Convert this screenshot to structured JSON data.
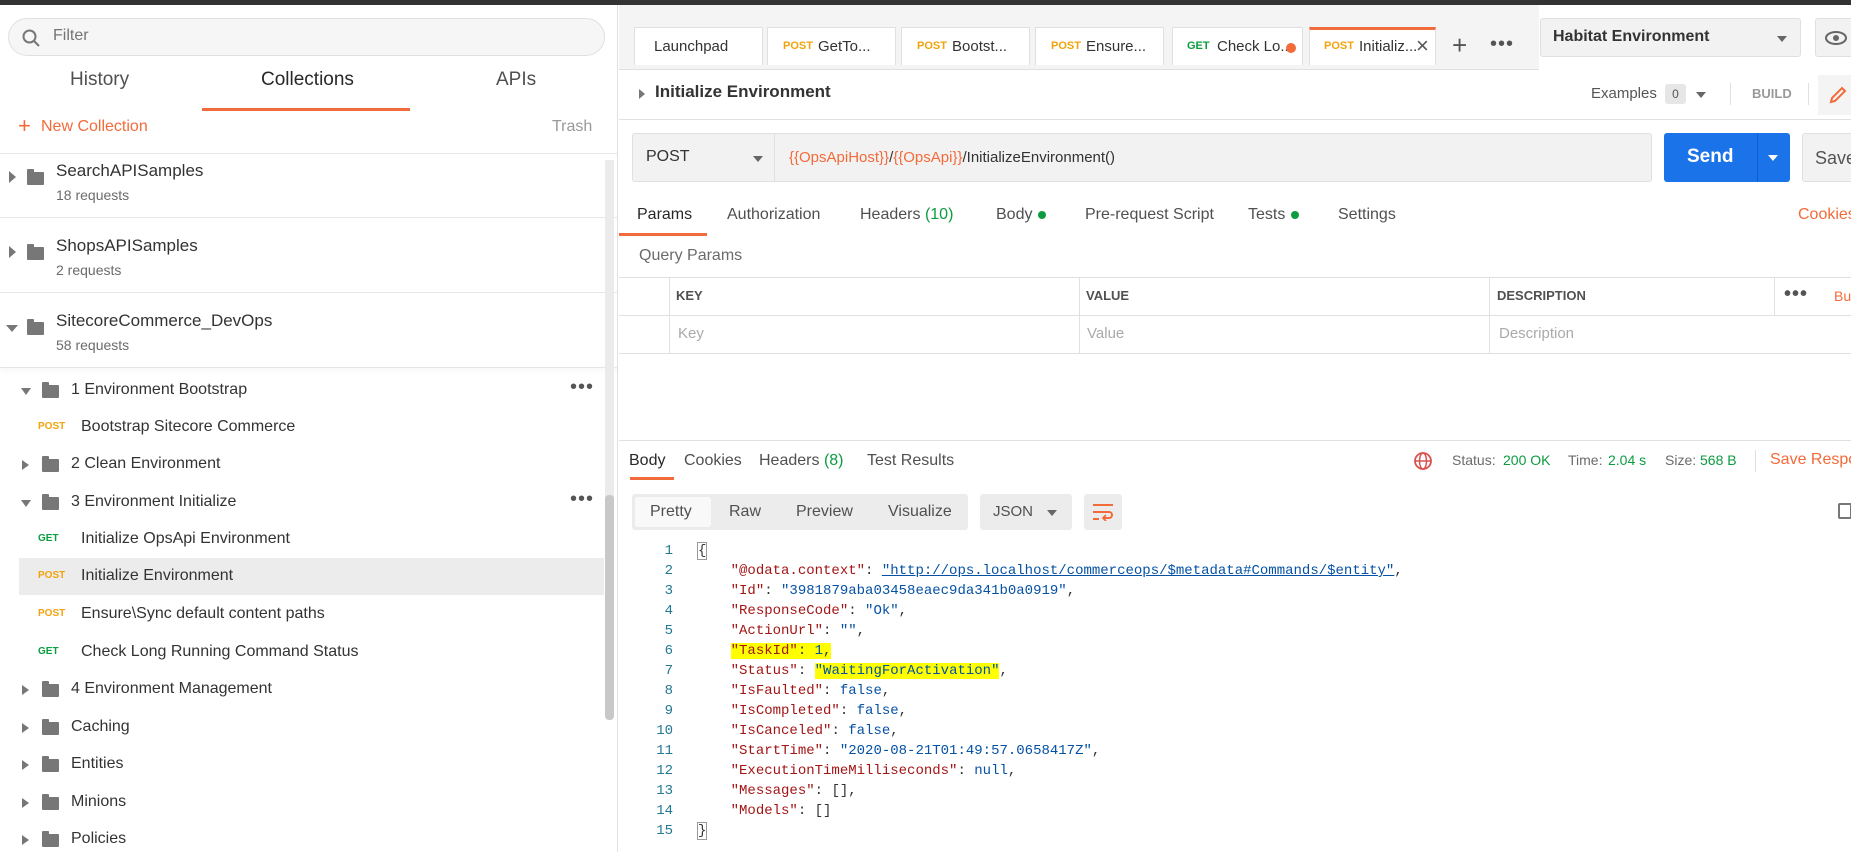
{
  "sidebar": {
    "filter_placeholder": "Filter",
    "tabs": [
      "History",
      "Collections",
      "APIs"
    ],
    "new_collection": "New Collection",
    "trash": "Trash",
    "collections": [
      {
        "name": "SearchAPISamples",
        "count": "18 requests"
      },
      {
        "name": "ShopsAPISamples",
        "count": "2 requests"
      },
      {
        "name": "SitecoreCommerce_DevOps",
        "count": "58 requests"
      }
    ],
    "tree": [
      {
        "label": "1 Environment Bootstrap"
      },
      {
        "method": "POST",
        "label": "Bootstrap Sitecore Commerce"
      },
      {
        "label": "2 Clean Environment"
      },
      {
        "label": "3 Environment Initialize"
      },
      {
        "method": "GET",
        "label": "Initialize OpsApi Environment"
      },
      {
        "method": "POST",
        "label": "Initialize Environment"
      },
      {
        "method": "POST",
        "label": "Ensure\\Sync default content paths"
      },
      {
        "method": "GET",
        "label": "Check Long Running Command Status"
      },
      {
        "label": "4 Environment Management"
      },
      {
        "label": "Caching"
      },
      {
        "label": "Entities"
      },
      {
        "label": "Minions"
      },
      {
        "label": "Policies"
      }
    ]
  },
  "tabs": [
    {
      "method": "",
      "label": "Launchpad"
    },
    {
      "method": "POST",
      "label": "GetTo..."
    },
    {
      "method": "POST",
      "label": "Bootst..."
    },
    {
      "method": "POST",
      "label": "Ensure..."
    },
    {
      "method": "GET",
      "label": "Check Lo..."
    },
    {
      "method": "POST",
      "label": "Initializ..."
    }
  ],
  "environment": "Habitat Environment",
  "request": {
    "title": "Initialize Environment",
    "examples_label": "Examples",
    "examples_count": "0",
    "build_label": "BUILD",
    "method": "POST",
    "url_var1": "{{OpsApiHost}}",
    "url_sep": "/",
    "url_var2": "{{OpsApi}}",
    "url_path": "/InitializeEnvironment()",
    "send": "Send",
    "save": "Save",
    "tabs": {
      "params": "Params",
      "authorization": "Authorization",
      "headers": "Headers",
      "headers_count": "(10)",
      "body": "Body",
      "prerequest": "Pre-request Script",
      "tests": "Tests",
      "settings": "Settings",
      "cookies": "Cookies"
    },
    "query_params_label": "Query Params",
    "table": {
      "headers": [
        "KEY",
        "VALUE",
        "DESCRIPTION"
      ],
      "bulk": "Bu",
      "placeholders": [
        "Key",
        "Value",
        "Description"
      ]
    }
  },
  "response": {
    "tabs": {
      "body": "Body",
      "cookies": "Cookies",
      "headers": "Headers",
      "headers_count": "(8)",
      "test_results": "Test Results"
    },
    "status_label": "Status:",
    "status": "200 OK",
    "time_label": "Time:",
    "time": "2.04 s",
    "size_label": "Size:",
    "size": "568 B",
    "save_response": "Save Respo",
    "formats": [
      "Pretty",
      "Raw",
      "Preview",
      "Visualize"
    ],
    "language": "JSON",
    "lines": [
      "1",
      "2",
      "3",
      "4",
      "5",
      "6",
      "7",
      "8",
      "9",
      "10",
      "11",
      "12",
      "13",
      "14",
      "15"
    ],
    "json": {
      "odata_key": "\"@odata.context\"",
      "odata_val": "\"http://ops.localhost/commerceops/$metadata#Commands/$entity\"",
      "id_key": "\"Id\"",
      "id_val": "\"3981879aba03458eaec9da341b0a0919\"",
      "rc_key": "\"ResponseCode\"",
      "rc_val": "\"Ok\"",
      "au_key": "\"ActionUrl\"",
      "au_val": "\"\"",
      "task_key": "\"TaskId\"",
      "task_val": "1",
      "status_key": "\"Status\"",
      "status_val": "\"WaitingForActivation\"",
      "faulted_key": "\"IsFaulted\"",
      "faulted_val": "false",
      "completed_key": "\"IsCompleted\"",
      "completed_val": "false",
      "canceled_key": "\"IsCanceled\"",
      "canceled_val": "false",
      "start_key": "\"StartTime\"",
      "start_val": "\"2020-08-21T01:49:57.0658417Z\"",
      "exec_key": "\"ExecutionTimeMilliseconds\"",
      "exec_val": "null",
      "msg_key": "\"Messages\"",
      "msg_val": "[]",
      "models_key": "\"Models\"",
      "models_val": "[]"
    }
  }
}
